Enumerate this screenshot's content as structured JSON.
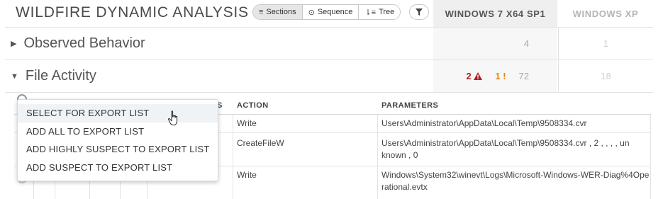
{
  "header": {
    "title": "WILDFIRE DYNAMIC ANALYSIS",
    "view_buttons": [
      {
        "label": "Sections",
        "icon": "list-icon",
        "icon_glyph": "≡",
        "active": true
      },
      {
        "label": "Sequence",
        "icon": "clock-icon",
        "icon_glyph": "⊙",
        "active": false
      },
      {
        "label": "Tree",
        "icon": "tree-sort-icon",
        "icon_glyph": "⇂≡",
        "active": false
      }
    ],
    "filter_icon": "funnel-icon"
  },
  "columns": {
    "win7": "WINDOWS 7 X64 SP1",
    "winxp": "WINDOWS XP"
  },
  "sections": [
    {
      "label": "Observed Behavior",
      "expanded": false,
      "win7": {
        "count": "4"
      },
      "winxp": {
        "count": "1"
      }
    },
    {
      "label": "File Activity",
      "expanded": true,
      "win7": {
        "high": "2",
        "medium": "1",
        "count": "72"
      },
      "winxp": {
        "count": "18"
      }
    }
  ],
  "table": {
    "headers": {
      "hidden_tail": "S",
      "action": "ACTION",
      "parameters": "PARAMETERS"
    },
    "rows": [
      {
        "action": "Write",
        "parameters": "Users\\Administrator\\AppData\\Local\\Temp\\9508334.cvr"
      },
      {
        "action": "CreateFileW",
        "parameters": "Users\\Administrator\\AppData\\Local\\Temp\\9508334.cvr , 2 , , , , un known , 0"
      },
      {
        "action": "Write",
        "parameters": "Windows\\System32\\winevt\\Logs\\Microsoft-Windows-WER-Diag%4Operational.evtx"
      }
    ]
  },
  "context_menu": {
    "items": [
      {
        "label": "SELECT FOR EXPORT LIST",
        "hovered": true
      },
      {
        "label": "ADD ALL TO EXPORT LIST",
        "hovered": false
      },
      {
        "label": "ADD HIGHLY SUSPECT TO EXPORT LIST",
        "hovered": false
      },
      {
        "label": "ADD SUSPECT TO EXPORT LIST",
        "hovered": false
      }
    ]
  },
  "colors": {
    "high_severity": "#b21f24",
    "medium_severity": "#d78a1c",
    "muted": "#a8a8a8",
    "column_highlight": "#efefef"
  }
}
